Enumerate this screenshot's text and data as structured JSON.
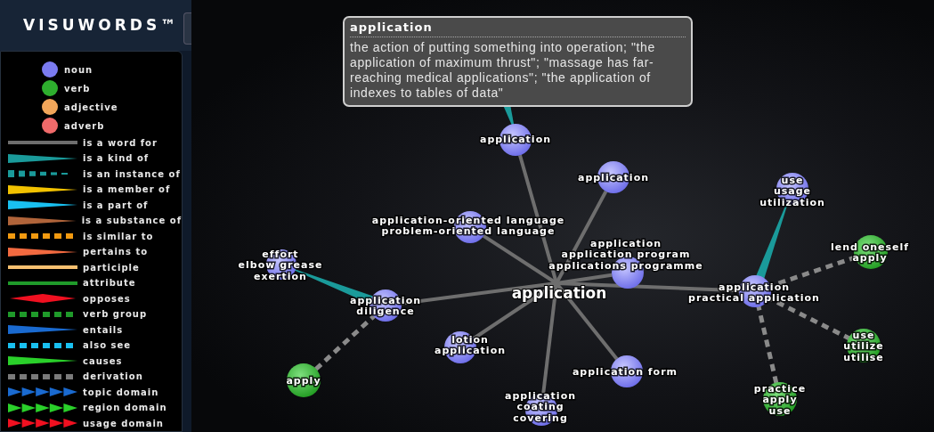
{
  "header": {
    "title": "VISUWORDS™"
  },
  "legend": {
    "parts_of_speech": [
      {
        "label": "noun",
        "color": "#7b7bf0"
      },
      {
        "label": "verb",
        "color": "#2eae2e"
      },
      {
        "label": "adjective",
        "color": "#f2a65a"
      },
      {
        "label": "adverb",
        "color": "#f06a6a"
      }
    ],
    "relations": [
      {
        "label": "is a word for",
        "kind": "solid",
        "color": "#6e6e6e"
      },
      {
        "label": "is a kind of",
        "kind": "taper",
        "color": "#1a9a9a"
      },
      {
        "label": "is an instance of",
        "kind": "dashed-taper",
        "color": "#1a9a9a"
      },
      {
        "label": "is a member of",
        "kind": "taper",
        "color": "#f2c200"
      },
      {
        "label": "is a part of",
        "kind": "taper",
        "color": "#19c0f0"
      },
      {
        "label": "is a substance of",
        "kind": "taper",
        "color": "#b0643a"
      },
      {
        "label": "is similar to",
        "kind": "dashed",
        "color": "#f29a10"
      },
      {
        "label": "pertains to",
        "kind": "taper",
        "color": "#f26a40"
      },
      {
        "label": "participle",
        "kind": "solid",
        "color": "#f7c070"
      },
      {
        "label": "attribute",
        "kind": "solid",
        "color": "#1f9a2a"
      },
      {
        "label": "opposes",
        "kind": "diamond",
        "color": "#f01020"
      },
      {
        "label": "verb group",
        "kind": "dashed",
        "color": "#1f9a2a"
      },
      {
        "label": "entails",
        "kind": "taper",
        "color": "#1a6ad0"
      },
      {
        "label": "also see",
        "kind": "dashed",
        "color": "#19c0f0"
      },
      {
        "label": "causes",
        "kind": "taper",
        "color": "#2ad02a"
      },
      {
        "label": "derivation",
        "kind": "dashed",
        "color": "#7a7a7a"
      },
      {
        "label": "topic domain",
        "kind": "arrows",
        "color": "#1a6ad0"
      },
      {
        "label": "region domain",
        "kind": "arrows",
        "color": "#2ad02a"
      },
      {
        "label": "usage domain",
        "kind": "arrows",
        "color": "#f01020"
      }
    ]
  },
  "graph": {
    "center": {
      "label": "application",
      "children": [
        {
          "labels": [
            "application"
          ],
          "kind": "noun",
          "edge": {
            "kind": "word_for"
          }
        },
        {
          "labels": [
            "application"
          ],
          "kind": "noun",
          "edge": {
            "kind": "word_for"
          }
        },
        {
          "labels": [
            "application-oriented language",
            "problem-oriented language"
          ],
          "kind": "noun",
          "edge": {
            "kind": "word_for"
          }
        },
        {
          "labels": [
            "application",
            "diligence"
          ],
          "kind": "noun",
          "edge": {
            "kind": "word_for"
          },
          "children": [
            {
              "labels": [
                "effort",
                "elbow grease",
                "exertion"
              ],
              "kind": "noun",
              "edge": {
                "kind": "kind_of"
              }
            },
            {
              "labels": [
                "apply"
              ],
              "kind": "verb",
              "edge": {
                "kind": "derivation"
              }
            }
          ]
        },
        {
          "labels": [
            "application",
            "application program",
            "applications programme"
          ],
          "kind": "noun",
          "edge": {
            "kind": "word_for"
          }
        },
        {
          "labels": [
            "application",
            "practical application"
          ],
          "kind": "noun",
          "edge": {
            "kind": "word_for"
          },
          "children": [
            {
              "labels": [
                "use",
                "usage",
                "utilization"
              ],
              "kind": "noun",
              "edge": {
                "kind": "kind_of"
              }
            },
            {
              "labels": [
                "lend oneself",
                "apply"
              ],
              "kind": "verb",
              "edge": {
                "kind": "derivation"
              }
            },
            {
              "labels": [
                "use",
                "utilize",
                "utilise"
              ],
              "kind": "verb",
              "edge": {
                "kind": "derivation"
              }
            },
            {
              "labels": [
                "practice",
                "apply",
                "use"
              ],
              "kind": "verb",
              "edge": {
                "kind": "derivation"
              }
            }
          ]
        },
        {
          "labels": [
            "lotion",
            "application"
          ],
          "kind": "noun",
          "edge": {
            "kind": "word_for"
          }
        },
        {
          "labels": [
            "application form"
          ],
          "kind": "noun",
          "edge": {
            "kind": "word_for"
          }
        },
        {
          "labels": [
            "application",
            "coating",
            "covering"
          ],
          "kind": "noun",
          "edge": {
            "kind": "word_for"
          }
        }
      ]
    }
  },
  "tooltip": {
    "title": "application",
    "definition": "the action of putting something into operation; \"the application of maximum thrust\"; \"massage has far-reaching medical applications\"; \"the application of indexes to tables of data\""
  }
}
